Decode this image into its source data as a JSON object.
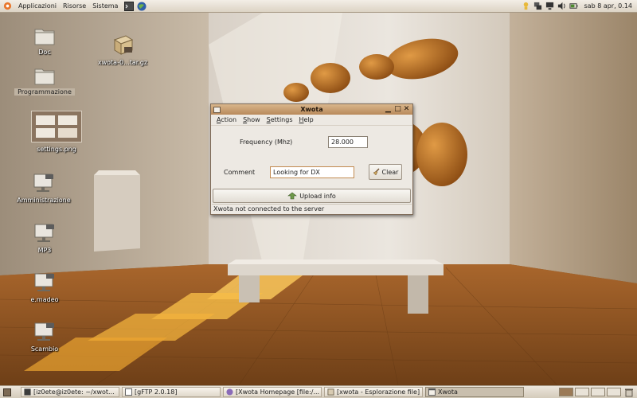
{
  "top_panel": {
    "menus": [
      "Applicazioni",
      "Risorse",
      "Sistema"
    ],
    "clock": "sab  8 apr,  0.14",
    "tray_icons": [
      "notification-icon",
      "network-icon",
      "monitor-icon",
      "volume-icon",
      "battery-icon",
      "power-icon"
    ]
  },
  "desktop": {
    "icons": [
      {
        "label": "Doc",
        "icon": "folder-icon"
      },
      {
        "label": "xwota-0...tar.gz",
        "icon": "archive-icon"
      },
      {
        "label": "Programmazione",
        "icon": "folder-icon"
      },
      {
        "label": "settings.png",
        "icon": "image-icon"
      },
      {
        "label": "Amministrazione",
        "icon": "network-share-icon"
      },
      {
        "label": "MP3",
        "icon": "network-share-icon"
      },
      {
        "label": "e.madeo",
        "icon": "network-share-icon"
      },
      {
        "label": "Scambio",
        "icon": "network-share-icon"
      }
    ]
  },
  "window": {
    "title": "Xwota",
    "menu": [
      {
        "first": "A",
        "rest": "ction"
      },
      {
        "first": "S",
        "rest": "how"
      },
      {
        "first": "S",
        "rest": "ettings"
      },
      {
        "first": "H",
        "rest": "elp"
      }
    ],
    "frequency_label": "Frequency (Mhz)",
    "frequency_value": "28.000",
    "comment_label": "Comment",
    "comment_value": "Looking for DX",
    "clear_label": "Clear",
    "upload_label": "Upload info",
    "status": "Xwota not connected to the server"
  },
  "taskbar": {
    "tasks": [
      {
        "label": "[iz0ete@iz0ete: ~/xwot...",
        "icon": "terminal-icon"
      },
      {
        "label": "[gFTP 2.0.18]",
        "icon": "ftp-icon"
      },
      {
        "label": "[Xwota Homepage [file:/...",
        "icon": "browser-icon"
      },
      {
        "label": "[xwota - Esplorazione file]",
        "icon": "file-manager-icon"
      },
      {
        "label": "Xwota",
        "icon": "window-icon"
      }
    ]
  },
  "colors": {
    "titlebar": "#c59a6a",
    "panel": "#e4ddd0",
    "window_bg": "#ede9e3",
    "floor": "#9a5a22"
  }
}
